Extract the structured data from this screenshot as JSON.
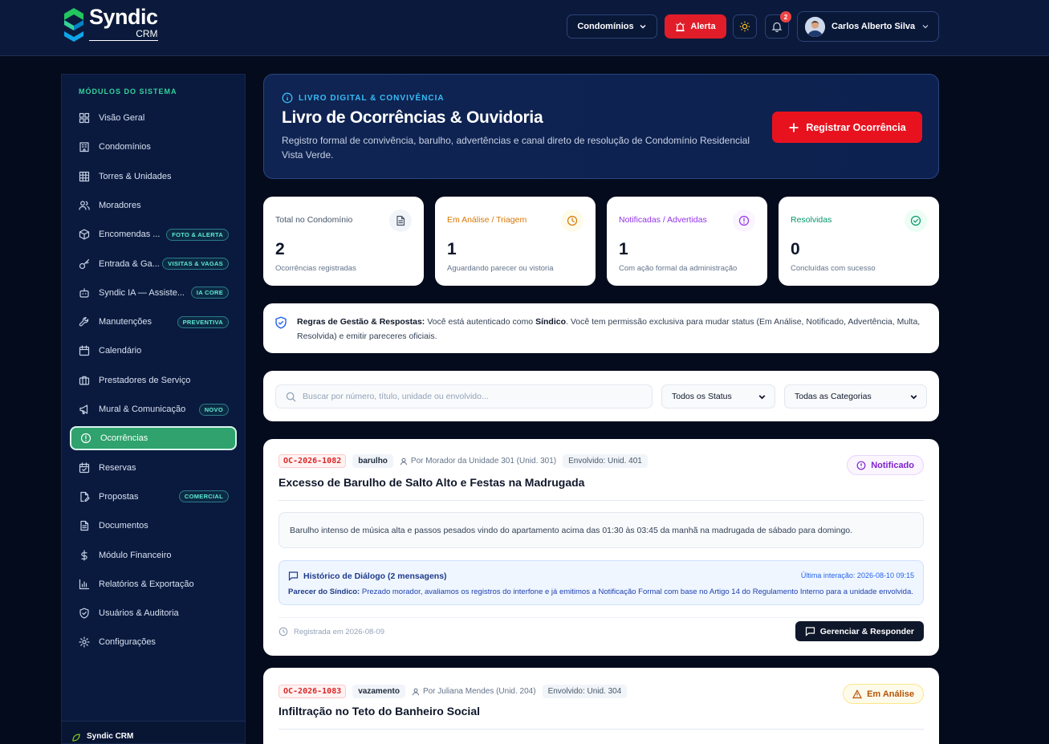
{
  "header": {
    "logo_name": "Syndic",
    "logo_sub": "CRM",
    "condos_label": "Condomínios",
    "alert_label": "Alerta",
    "notifications_count": "2",
    "user_name": "Carlos Alberto Silva"
  },
  "sidebar": {
    "title": "MÓDULOS DO SISTEMA",
    "items": [
      {
        "label": "Visão Geral",
        "icon": "grid-icon"
      },
      {
        "label": "Condomínios",
        "icon": "building-icon"
      },
      {
        "label": "Torres & Unidades",
        "icon": "table-icon"
      },
      {
        "label": "Moradores",
        "icon": "users-icon"
      },
      {
        "label": "Encomendas ...",
        "icon": "package-icon",
        "badge": "FOTO & ALERTA"
      },
      {
        "label": "Entrada & Ga...",
        "icon": "key-icon",
        "badge": "VISITAS & VAGAS"
      },
      {
        "label": "Syndic IA — Assiste...",
        "icon": "bot-icon",
        "badge": "IA CORE"
      },
      {
        "label": "Manutenções",
        "icon": "wrench-icon",
        "badge": "PREVENTIVA"
      },
      {
        "label": "Calendário",
        "icon": "calendar-icon"
      },
      {
        "label": "Prestadores de Serviço",
        "icon": "briefcase-icon"
      },
      {
        "label": "Mural & Comunicação",
        "icon": "megaphone-icon",
        "badge": "NOVO"
      },
      {
        "label": "Ocorrências",
        "icon": "alert-circle-icon",
        "active": true
      },
      {
        "label": "Reservas",
        "icon": "calendar-check-icon"
      },
      {
        "label": "Propostas",
        "icon": "file-edit-icon",
        "badge": "COMERCIAL"
      },
      {
        "label": "Documentos",
        "icon": "file-text-icon"
      },
      {
        "label": "Módulo Financeiro",
        "icon": "dollar-icon"
      },
      {
        "label": "Relatórios & Exportação",
        "icon": "bar-chart-icon"
      },
      {
        "label": "Usuários & Auditoria",
        "icon": "shield-check-icon"
      },
      {
        "label": "Configurações",
        "icon": "gear-icon"
      }
    ],
    "footer": "Syndic CRM"
  },
  "hero": {
    "kicker": "LIVRO DIGITAL & CONVIVÊNCIA",
    "title": "Livro de Ocorrências & Ouvidoria",
    "description": "Registro formal de convivência, barulho, advertências e canal direto de resolução de Condomínio Residencial Vista Verde.",
    "button": "Registrar Ocorrência"
  },
  "stats": [
    {
      "label": "Total no Condomínio",
      "value": "2",
      "sub": "Ocorrências registradas",
      "color": "#475569",
      "icon": "file-icon"
    },
    {
      "label": "Em Análise / Triagem",
      "value": "1",
      "sub": "Aguardando parecer ou vistoria",
      "color": "#d97706",
      "icon": "clock-icon"
    },
    {
      "label": "Notificadas / Advertidas",
      "value": "1",
      "sub": "Com ação formal da administração",
      "color": "#9333ea",
      "icon": "alert-circle-icon"
    },
    {
      "label": "Resolvidas",
      "value": "0",
      "sub": "Concluídas com sucesso",
      "color": "#059669",
      "icon": "check-circle-icon"
    }
  ],
  "rules": {
    "title": "Regras de Gestão & Respostas:",
    "text1": " Você está autenticado como ",
    "role": "Síndico",
    "text2": ". Você tem permissão exclusiva para mudar status (Em Análise, Notificado, Advertência, Multa, Resolvida) e emitir pareceres oficiais."
  },
  "filters": {
    "search_placeholder": "Buscar por número, título, unidade ou envolvido...",
    "status_selected": "Todos os Status",
    "category_selected": "Todas as Categorias"
  },
  "occurrences": [
    {
      "code": "OC-2026-1082",
      "category": "barulho",
      "by": "Por Morador da Unidade 301 (Unid. 301)",
      "involved": "Envolvido: Unid. 401",
      "status": "Notificado",
      "title": "Excesso de Barulho de Salto Alto e Festas na Madrugada",
      "description": "Barulho intenso de música alta e passos pesados vindo do apartamento acima das 01:30 às 03:45 da manhã na madrugada de sábado para domingo.",
      "history_title": "Histórico de Diálogo (2 mensagens)",
      "history_last": "Última interação: 2026-08-10 09:15",
      "history_author": "Parecer do Síndico:",
      "history_message": " Prezado morador, avaliamos os registros do interfone e já emitimos a Notificação Formal com base no Artigo 14 do Regulamento Interno para a unidade envolvida.",
      "registered": "Registrada em 2026-08-09",
      "manage": "Gerenciar & Responder"
    },
    {
      "code": "OC-2026-1083",
      "category": "vazamento",
      "by": "Por Juliana Mendes (Unid. 204)",
      "involved": "Envolvido: Unid. 304",
      "status": "Em Análise",
      "title": "Infiltração no Teto do Banheiro Social"
    }
  ]
}
